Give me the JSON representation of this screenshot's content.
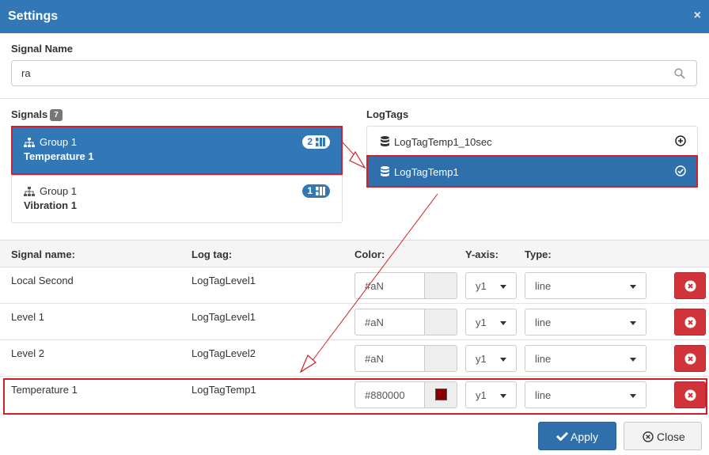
{
  "dialog": {
    "title": "Settings",
    "close_glyph": "×"
  },
  "signal_name": {
    "label": "Signal Name",
    "value": "ra"
  },
  "signals": {
    "label": "Signals",
    "count": "7",
    "items": [
      {
        "group": "Group 1",
        "name": "Temperature 1",
        "count": "2",
        "active": true
      },
      {
        "group": "Group 1",
        "name": "Vibration 1",
        "count": "1",
        "active": false
      }
    ]
  },
  "logtags": {
    "label": "LogTags",
    "items": [
      {
        "name": "LogTagTemp1_10sec",
        "action_icon": "plus-circle-icon",
        "active": false
      },
      {
        "name": "LogTagTemp1",
        "action_icon": "check-circle-icon",
        "active": true
      }
    ]
  },
  "table": {
    "headers": [
      "Signal name:",
      "Log tag:",
      "Color:",
      "Y-axis:",
      "Type:"
    ],
    "rows": [
      {
        "signal": "Local Second",
        "logtag": "LogTagLevel1",
        "color": "#aN",
        "yaxis": "y1",
        "type": "line"
      },
      {
        "signal": "Level 1",
        "logtag": "LogTagLevel1",
        "color": "#aN",
        "yaxis": "y1",
        "type": "line"
      },
      {
        "signal": "Level 2",
        "logtag": "LogTagLevel2",
        "color": "#aN",
        "yaxis": "y1",
        "type": "line"
      },
      {
        "signal": "Temperature 1",
        "logtag": "LogTagTemp1",
        "color": "#880000",
        "yaxis": "y1",
        "type": "line",
        "swatch": "#880000"
      }
    ]
  },
  "buttons": {
    "apply": "Apply",
    "close": "Close"
  },
  "colors": {
    "primary": "#3278b7",
    "danger": "#d0343a",
    "highlight": "#d0202a"
  }
}
